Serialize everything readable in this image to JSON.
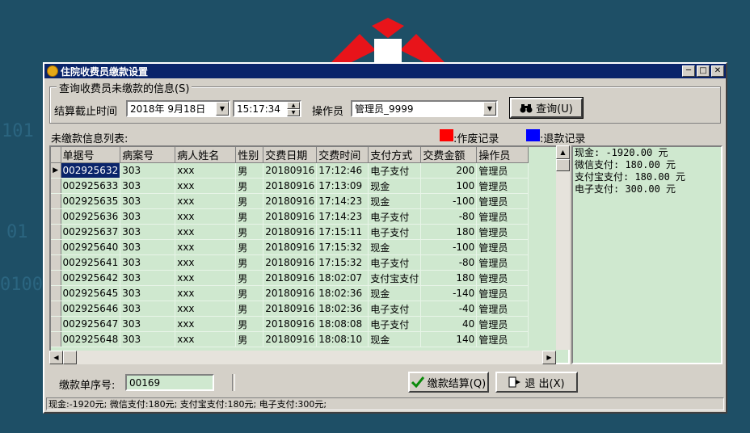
{
  "window": {
    "title": "住院收费员缴款设置"
  },
  "query_group": {
    "label": "查询收费员未缴款的信息(S)",
    "settle_label": "结算截止时间",
    "date_value": "2018年 9月18日",
    "time_value": "15:17:34",
    "operator_label": "操作员",
    "operator_value": "管理员_9999",
    "query_button": "查询(U)"
  },
  "legend": {
    "list_label": "未缴款信息列表:",
    "void_label": ":作废记录",
    "void_color": "#ff0000",
    "refund_label": ":退款记录",
    "refund_color": "#0000ff"
  },
  "table": {
    "columns": [
      "单据号",
      "病案号",
      "病人姓名",
      "性别",
      "交费日期",
      "交费时间",
      "支付方式",
      "交费金额",
      "操作员"
    ],
    "rows": [
      [
        "002925632",
        "303",
        "xxx",
        "男",
        "20180916",
        "17:12:46",
        "电子支付",
        "200",
        "管理员"
      ],
      [
        "002925633",
        "303",
        "xxx",
        "男",
        "20180916",
        "17:13:09",
        "现金",
        "100",
        "管理员"
      ],
      [
        "002925635",
        "303",
        "xxx",
        "男",
        "20180916",
        "17:14:23",
        "现金",
        "-100",
        "管理员"
      ],
      [
        "002925636",
        "303",
        "xxx",
        "男",
        "20180916",
        "17:14:23",
        "电子支付",
        "-80",
        "管理员"
      ],
      [
        "002925637",
        "303",
        "xxx",
        "男",
        "20180916",
        "17:15:11",
        "电子支付",
        "180",
        "管理员"
      ],
      [
        "002925640",
        "303",
        "xxx",
        "男",
        "20180916",
        "17:15:32",
        "现金",
        "-100",
        "管理员"
      ],
      [
        "002925641",
        "303",
        "xxx",
        "男",
        "20180916",
        "17:15:32",
        "电子支付",
        "-80",
        "管理员"
      ],
      [
        "002925642",
        "303",
        "xxx",
        "男",
        "20180916",
        "18:02:07",
        "支付宝支付",
        "180",
        "管理员"
      ],
      [
        "002925645",
        "303",
        "xxx",
        "男",
        "20180916",
        "18:02:36",
        "现金",
        "-140",
        "管理员"
      ],
      [
        "002925646",
        "303",
        "xxx",
        "男",
        "20180916",
        "18:02:36",
        "电子支付",
        "-40",
        "管理员"
      ],
      [
        "002925647",
        "303",
        "xxx",
        "男",
        "20180916",
        "18:08:08",
        "电子支付",
        "40",
        "管理员"
      ],
      [
        "002925648",
        "303",
        "xxx",
        "男",
        "20180916",
        "18:08:10",
        "现金",
        "140",
        "管理员"
      ]
    ]
  },
  "summary": {
    "lines": [
      "现金: -1920.00 元",
      "微信支付: 180.00 元",
      "支付宝支付: 180.00 元",
      "电子支付: 300.00 元"
    ]
  },
  "footer": {
    "seq_label": "缴款单序号:",
    "seq_value": "00169",
    "settle_button": "缴款结算(Q)",
    "exit_button": "退  出(X)"
  },
  "statusbar": {
    "text": "现金:-1920元; 微信支付:180元; 支付宝支付:180元; 电子支付:300元;"
  },
  "background": {
    "numbers": [
      "101",
      "01",
      "0100"
    ]
  }
}
